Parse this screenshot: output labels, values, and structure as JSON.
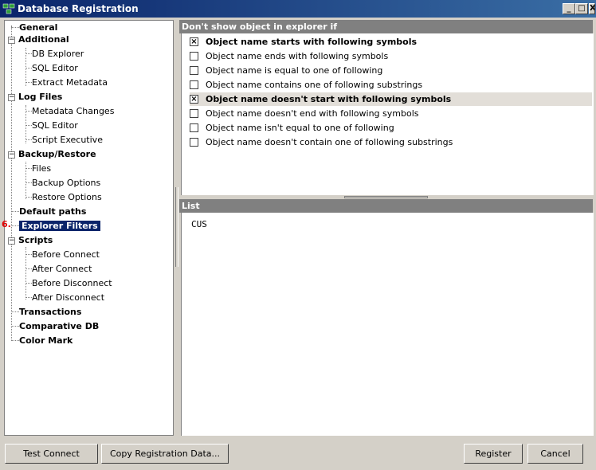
{
  "window": {
    "title": "Database Registration",
    "controls": [
      "_",
      "□",
      "X"
    ]
  },
  "tree": {
    "items": [
      {
        "label": "General",
        "bold": true
      },
      {
        "label": "Additional",
        "bold": true
      },
      {
        "label": "DB Explorer",
        "bold": false
      },
      {
        "label": "SQL Editor",
        "bold": false
      },
      {
        "label": "Extract Metadata",
        "bold": false
      },
      {
        "label": "Log Files",
        "bold": true
      },
      {
        "label": "Metadata Changes",
        "bold": false
      },
      {
        "label": "SQL Editor",
        "bold": false
      },
      {
        "label": "Script Executive",
        "bold": false
      },
      {
        "label": "Backup/Restore",
        "bold": true
      },
      {
        "label": "Files",
        "bold": false
      },
      {
        "label": "Backup Options",
        "bold": false
      },
      {
        "label": "Restore Options",
        "bold": false
      },
      {
        "label": "Default paths",
        "bold": true
      },
      {
        "label": "Explorer Filters",
        "bold": true
      },
      {
        "label": "Scripts",
        "bold": true
      },
      {
        "label": "Before Connect",
        "bold": false
      },
      {
        "label": "After Connect",
        "bold": false
      },
      {
        "label": "Before Disconnect",
        "bold": false
      },
      {
        "label": "After Disconnect",
        "bold": false
      },
      {
        "label": "Transactions",
        "bold": true
      },
      {
        "label": "Comparative DB",
        "bold": true
      },
      {
        "label": "Color Mark",
        "bold": true
      }
    ],
    "selected": "Explorer Filters",
    "marker": "6."
  },
  "filters": {
    "header": "Don't show object in explorer if",
    "options": [
      {
        "label": "Object name starts with following symbols",
        "checked": true
      },
      {
        "label": "Object name ends with following symbols",
        "checked": false
      },
      {
        "label": "Object name is equal to one of following",
        "checked": false
      },
      {
        "label": "Object name contains one of following substrings",
        "checked": false
      },
      {
        "label": "Object name doesn't start with following symbols",
        "checked": true
      },
      {
        "label": "Object name doesn't end with following symbols",
        "checked": false
      },
      {
        "label": "Object name isn't equal to one of following",
        "checked": false
      },
      {
        "label": "Object name doesn't contain one of following substrings",
        "checked": false
      }
    ]
  },
  "list": {
    "header": "List",
    "content": "CUS"
  },
  "buttons": {
    "test_connect": "Test Connect",
    "copy_registration": "Copy Registration Data...",
    "register": "Register",
    "cancel": "Cancel"
  }
}
